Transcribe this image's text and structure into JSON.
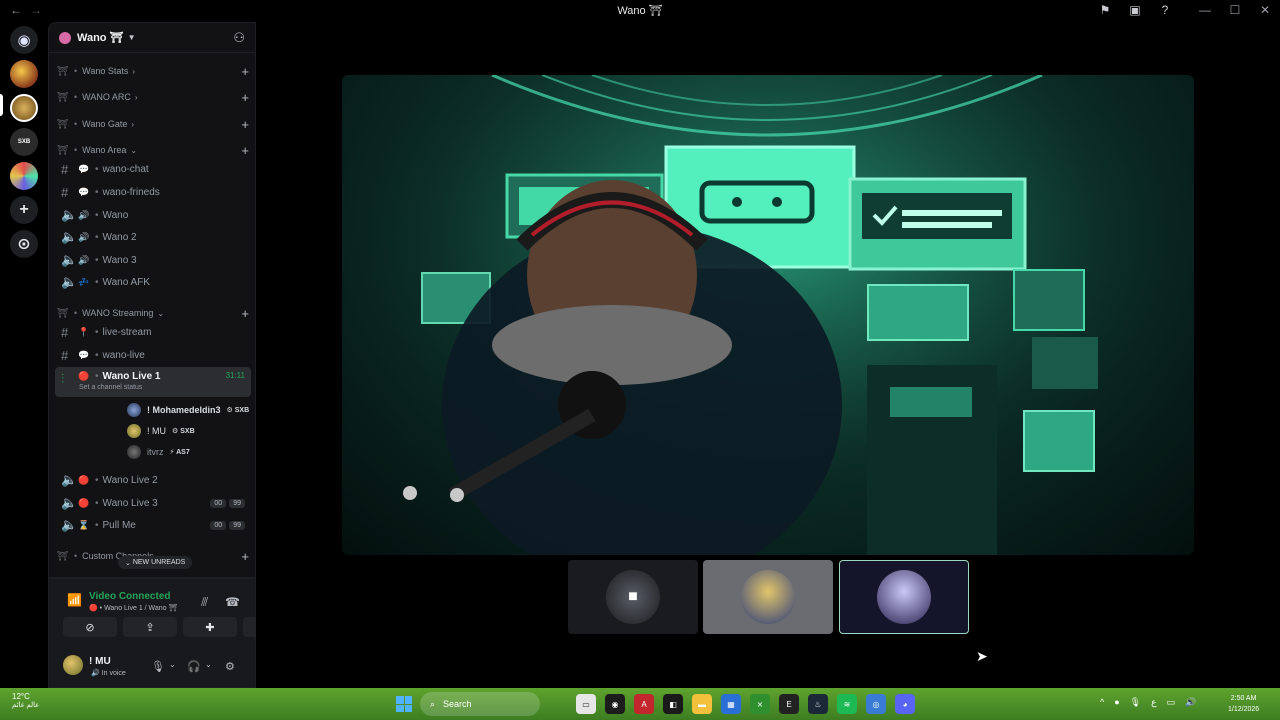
{
  "window": {
    "title": "Wano ⛩",
    "nav_back": "←",
    "nav_forward": "→"
  },
  "server": {
    "name": "Wano ⛩"
  },
  "categories": [
    {
      "label": "Wano Stats"
    },
    {
      "label": "WANO ARC"
    },
    {
      "label": "Wano Gate"
    },
    {
      "label": "Wano Area"
    },
    {
      "label": "WANO Streaming"
    },
    {
      "label": "Custom Channels"
    }
  ],
  "channels": {
    "wano_chat": "wano-chat",
    "wano_frineds": "wano-frineds",
    "wano": "Wano",
    "wano2": "Wano 2",
    "wano3": "Wano 3",
    "wano_afk": "Wano AFK",
    "live_stream": "live-stream",
    "wano_live": "wano-live",
    "wano_live1": "Wano Live 1",
    "wano_live1_timer": "31:11",
    "wano_live1_status": "Set a channel status",
    "wano_live2": "Wano Live 2",
    "wano_live3": "Wano Live 3",
    "wano_live3_b1": "00",
    "wano_live3_b2": "99",
    "pull_me": "Pull Me",
    "pull_me_b1": "00",
    "pull_me_b2": "99"
  },
  "voice_users": [
    {
      "name": "! Mohamedeldin3",
      "tag": "SXB"
    },
    {
      "name": "! MU",
      "tag": "SXB"
    },
    {
      "name": "itvrz",
      "tag": "AS7"
    }
  ],
  "new_unreads": "NEW UNREADS",
  "voice_panel": {
    "status": "Video Connected",
    "location": "Wano Live 1 / Wano ⛩"
  },
  "user": {
    "name": "! MU",
    "status": "In voice"
  },
  "taskbar": {
    "temperature": "12°C",
    "weather_text": "عالم غائم",
    "search_label": "Search",
    "time": "2:50 AM",
    "date": "1/12/2026",
    "lang": "ع"
  },
  "colors": {
    "accent_green": "#23a55a",
    "sidebar_bg": "#121214",
    "taskbar_green": "#5fa32e"
  }
}
